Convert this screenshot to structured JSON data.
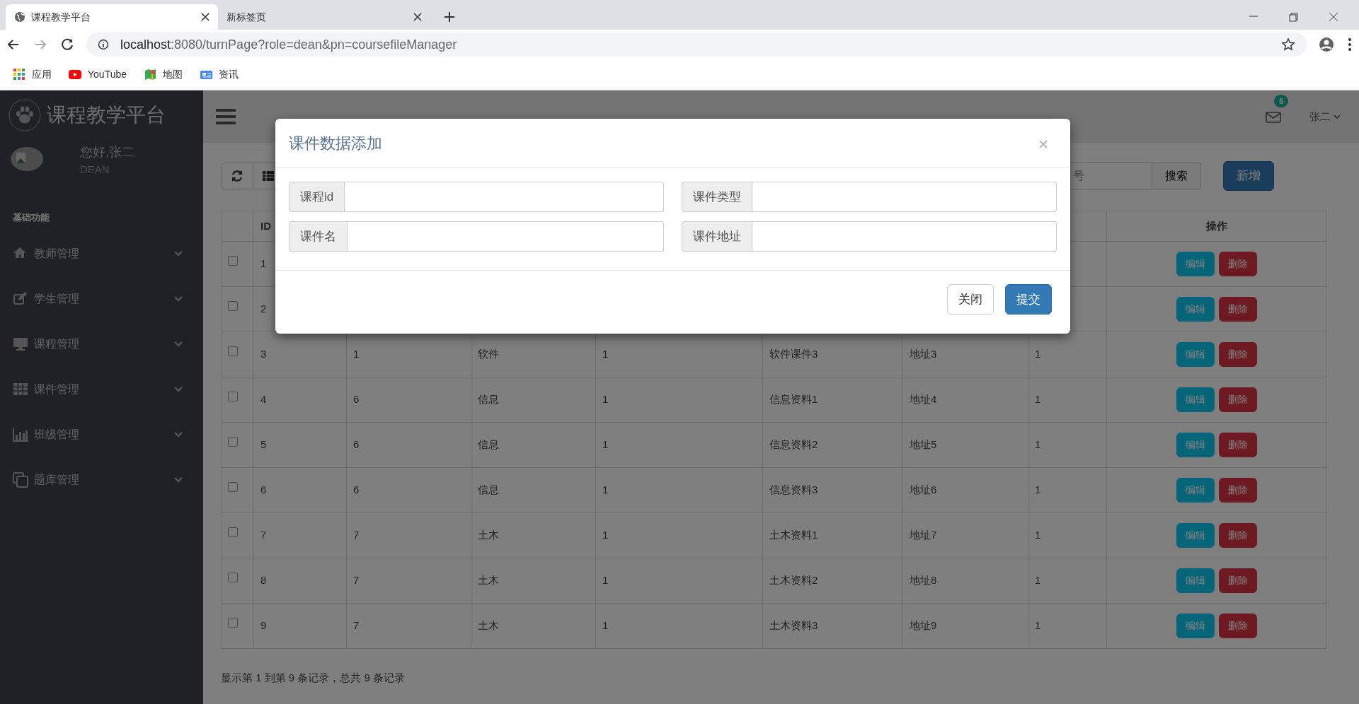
{
  "browser": {
    "tabs": [
      {
        "title": "课程教学平台",
        "selected": true
      },
      {
        "title": "新标签页",
        "selected": false
      }
    ],
    "address": {
      "host": "localhost",
      "path": ":8080/turnPage?role=dean&pn=coursefileManager"
    },
    "bookmarks": [
      {
        "label": "应用"
      },
      {
        "label": "YouTube"
      },
      {
        "label": "地图"
      },
      {
        "label": "资讯"
      }
    ]
  },
  "sidebar": {
    "title": "课程教学平台",
    "greeting": "您好,张二",
    "role": "DEAN",
    "section": "基础功能",
    "items": [
      {
        "label": "教师管理",
        "expanded": false
      },
      {
        "label": "学生管理",
        "expanded": false
      },
      {
        "label": "课程管理",
        "expanded": false
      },
      {
        "label": "课件管理",
        "expanded": false
      },
      {
        "label": "班级管理",
        "expanded": false
      },
      {
        "label": "题库管理",
        "expanded": false
      }
    ]
  },
  "header": {
    "badge": "6",
    "user": "张二"
  },
  "toolbar": {
    "search_placeholder": "号",
    "search_button": "搜索",
    "add_button": "新增"
  },
  "table": {
    "id_column": "ID",
    "actions_column": "操作",
    "rows": [
      {
        "id": "1",
        "checked": false,
        "actions": [
          "编辑",
          "删除"
        ]
      },
      {
        "id": "2",
        "checked": false,
        "actions": [
          "编辑",
          "删除"
        ]
      },
      {
        "id": "3",
        "checked": false,
        "cells": [
          "1",
          "软件",
          "1",
          "软件课件3",
          "地址3",
          "1"
        ],
        "actions": [
          "编辑",
          "删除"
        ]
      },
      {
        "id": "4",
        "checked": false,
        "cells": [
          "6",
          "信息",
          "1",
          "信息资料1",
          "地址4",
          "1"
        ],
        "actions": [
          "编辑",
          "删除"
        ]
      },
      {
        "id": "5",
        "checked": false,
        "cells": [
          "6",
          "信息",
          "1",
          "信息资料2",
          "地址5",
          "1"
        ],
        "actions": [
          "编辑",
          "删除"
        ]
      },
      {
        "id": "6",
        "checked": false,
        "cells": [
          "6",
          "信息",
          "1",
          "信息资料3",
          "地址6",
          "1"
        ],
        "actions": [
          "编辑",
          "删除"
        ]
      },
      {
        "id": "7",
        "checked": false,
        "cells": [
          "7",
          "土木",
          "1",
          "土木资料1",
          "地址7",
          "1"
        ],
        "actions": [
          "编辑",
          "删除"
        ]
      },
      {
        "id": "8",
        "checked": false,
        "cells": [
          "7",
          "土木",
          "1",
          "土木资料2",
          "地址8",
          "1"
        ],
        "actions": [
          "编辑",
          "删除"
        ]
      },
      {
        "id": "9",
        "checked": false,
        "cells": [
          "7",
          "土木",
          "1",
          "土木资料3",
          "地址9",
          "1"
        ],
        "actions": [
          "编辑",
          "删除"
        ]
      }
    ]
  },
  "footer": "显示第 1 到第 9 条记录，总共 9 条记录",
  "modal": {
    "title": "课件数据添加",
    "fields": [
      {
        "label": "课程id"
      },
      {
        "label": "课件类型"
      },
      {
        "label": "课件名"
      },
      {
        "label": "课件地址"
      }
    ],
    "buttons": [
      {
        "label": "关闭",
        "kind": "secondary"
      },
      {
        "label": "提交",
        "kind": "primary"
      }
    ]
  }
}
